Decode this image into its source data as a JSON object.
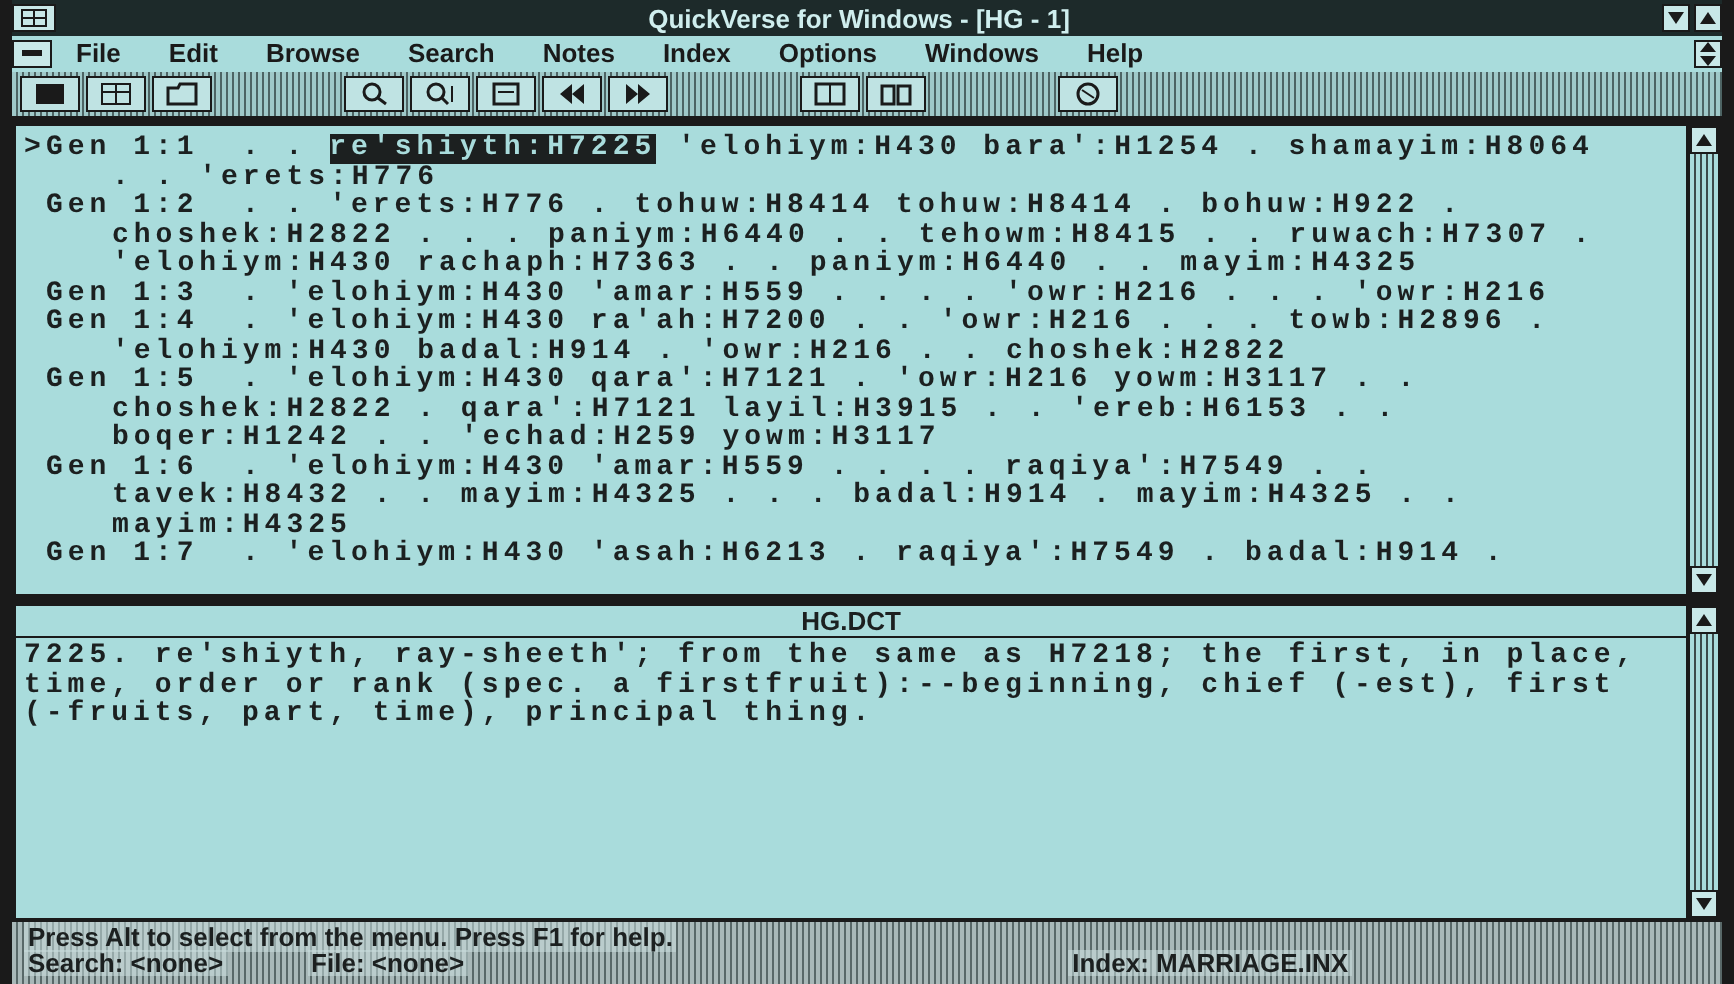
{
  "window": {
    "title": "QuickVerse for Windows - [HG - 1]"
  },
  "menu": [
    "File",
    "Edit",
    "Browse",
    "Search",
    "Notes",
    "Index",
    "Options",
    "Windows",
    "Help"
  ],
  "verses": [
    {
      "marker": ">",
      "ref": "Gen 1:1",
      "lines": [
        [
          {
            "text": ". . ",
            "highlighted": false
          },
          {
            "text": "re'shiyth:H7225",
            "highlighted": true
          },
          {
            "text": " 'elohiym:H430 bara':H1254 . shamayim:H8064",
            "highlighted": false
          }
        ],
        [
          {
            "text": ". . 'erets:H776",
            "highlighted": false
          }
        ]
      ]
    },
    {
      "ref": "Gen 1:2",
      "lines": [
        [
          {
            "text": ". . 'erets:H776 . tohuw:H8414 tohuw:H8414 . bohuw:H922 .",
            "highlighted": false
          }
        ],
        [
          {
            "text": "choshek:H2822 . . . paniym:H6440 . . tehowm:H8415 . . ruwach:H7307 .",
            "highlighted": false
          }
        ],
        [
          {
            "text": "'elohiym:H430 rachaph:H7363 . . paniym:H6440 . . mayim:H4325",
            "highlighted": false
          }
        ]
      ]
    },
    {
      "ref": "Gen 1:3",
      "lines": [
        [
          {
            "text": ". 'elohiym:H430 'amar:H559 . . . . 'owr:H216 . . . 'owr:H216",
            "highlighted": false
          }
        ]
      ]
    },
    {
      "ref": "Gen 1:4",
      "lines": [
        [
          {
            "text": ". 'elohiym:H430 ra'ah:H7200 . . 'owr:H216 . . . towb:H2896 .",
            "highlighted": false
          }
        ],
        [
          {
            "text": "'elohiym:H430 badal:H914 . 'owr:H216 . . choshek:H2822",
            "highlighted": false
          }
        ]
      ]
    },
    {
      "ref": "Gen 1:5",
      "lines": [
        [
          {
            "text": ". 'elohiym:H430 qara':H7121 . 'owr:H216 yowm:H3117 . .",
            "highlighted": false
          }
        ],
        [
          {
            "text": "choshek:H2822 . qara':H7121 layil:H3915 . . 'ereb:H6153 . .",
            "highlighted": false
          }
        ],
        [
          {
            "text": "boqer:H1242 . . 'echad:H259 yowm:H3117",
            "highlighted": false
          }
        ]
      ]
    },
    {
      "ref": "Gen 1:6",
      "lines": [
        [
          {
            "text": ". 'elohiym:H430 'amar:H559 . . . . raqiya':H7549 . .",
            "highlighted": false
          }
        ],
        [
          {
            "text": "tavek:H8432 . . mayim:H4325 . . . badal:H914 . mayim:H4325 . .",
            "highlighted": false
          }
        ],
        [
          {
            "text": "mayim:H4325",
            "highlighted": false
          }
        ]
      ]
    },
    {
      "ref": "Gen 1:7",
      "lines": [
        [
          {
            "text": ". 'elohiym:H430 'asah:H6213 . raqiya':H7549 . badal:H914 .",
            "highlighted": false
          }
        ]
      ]
    }
  ],
  "dictionary": {
    "title": "HG.DCT",
    "text": "7225. re'shiyth, ray-sheeth'; from the same as H7218; the first, in place, time, order or rank (spec. a firstfruit):--beginning, chief (-est), first (-fruits, part, time), principal thing."
  },
  "status_bar": {
    "message": "Press Alt to select from the menu. Press F1 for help.",
    "fields": [
      "Search: <none>",
      "File: <none>",
      "Index: MARRIAGE.INX"
    ]
  }
}
